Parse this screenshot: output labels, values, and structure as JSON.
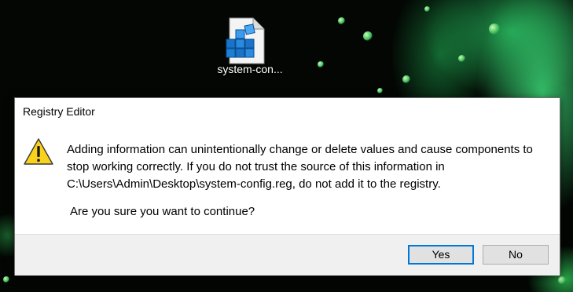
{
  "desktop": {
    "icon": {
      "name": "registry-file-icon",
      "label": "system-con..."
    }
  },
  "dialog": {
    "title": "Registry Editor",
    "icon": "warning-icon",
    "message_line1": "Adding information can unintentionally change or delete values and cause components to",
    "message_line2": "stop working correctly. If you do not trust the source of this information in",
    "message_line3": "C:\\Users\\Admin\\Desktop\\system-config.reg, do not add it to the registry.",
    "question": "Are you sure you want to continue?",
    "buttons": {
      "yes": "Yes",
      "no": "No"
    }
  },
  "colors": {
    "accent": "#0078d7",
    "warning": "#f8d21b"
  }
}
